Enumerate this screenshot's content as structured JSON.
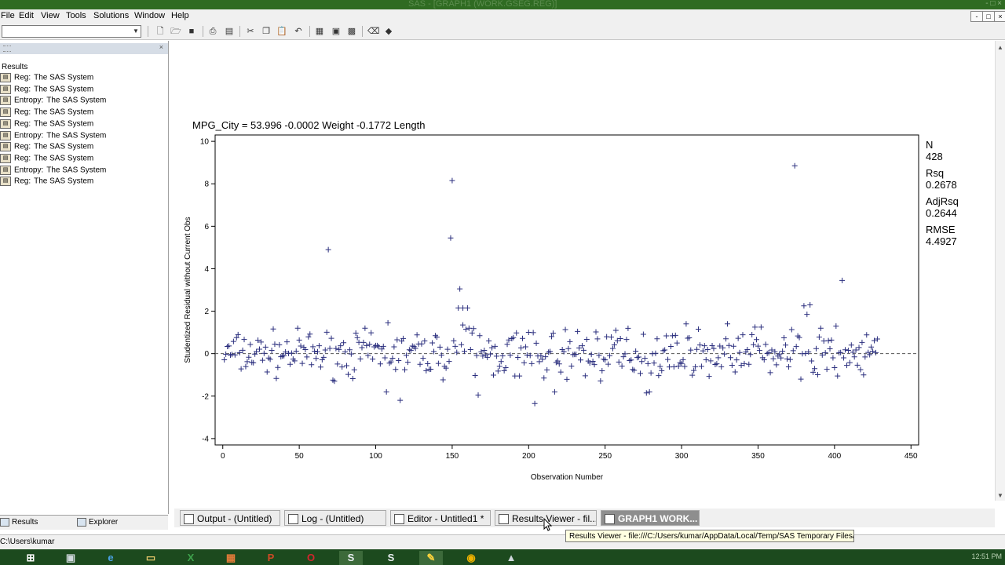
{
  "window": {
    "title": "SAS - [GRAPH1 (WORK.GSEG.REG)]",
    "controls": "- □ ×"
  },
  "menu": [
    "File",
    "Edit",
    "View",
    "Tools",
    "Solutions",
    "Window",
    "Help"
  ],
  "mdi_controls": [
    "-",
    "□",
    "×"
  ],
  "toolbar": {
    "command_value": "",
    "icons": [
      "new-icon",
      "open-icon",
      "save-icon",
      "print-icon",
      "print-preview-icon",
      "cut-icon",
      "copy-icon",
      "paste-icon",
      "undo-icon",
      "results-icon",
      "explorer-icon",
      "libraries-icon",
      "clear-icon",
      "help-icon"
    ]
  },
  "results_pane": {
    "root": "Results",
    "items": [
      {
        "proc": "Reg:",
        "name": "The SAS System"
      },
      {
        "proc": "Reg:",
        "name": "The SAS System"
      },
      {
        "proc": "Entropy:",
        "name": "The SAS System"
      },
      {
        "proc": "Reg:",
        "name": "The SAS System"
      },
      {
        "proc": "Reg:",
        "name": "The SAS System"
      },
      {
        "proc": "Entropy:",
        "name": "The SAS System"
      },
      {
        "proc": "Reg:",
        "name": "The SAS System"
      },
      {
        "proc": "Reg:",
        "name": "The SAS System"
      },
      {
        "proc": "Entropy:",
        "name": "The SAS System"
      },
      {
        "proc": "Reg:",
        "name": "The SAS System"
      }
    ],
    "tabs": [
      "Results",
      "Explorer"
    ]
  },
  "chart_data": {
    "type": "scatter",
    "title": "MPG_City = 53.996 -0.0002 Weight -0.1772 Length",
    "xlabel": "Observation Number",
    "ylabel": "Studentized Residual without Current Obs",
    "xlim": [
      -5,
      455
    ],
    "ylim": [
      -4.3,
      10.3
    ],
    "xticks": [
      0,
      50,
      100,
      150,
      200,
      250,
      300,
      350,
      400,
      450
    ],
    "yticks": [
      -4,
      -2,
      0,
      2,
      4,
      6,
      8,
      10
    ],
    "marker": "plus",
    "marker_color": "#2b2f7e",
    "reference_line_y": 0,
    "stats": [
      {
        "label": "N",
        "value": "428"
      },
      {
        "label": "Rsq",
        "value": "0.2678"
      },
      {
        "label": "AdjRsq",
        "value": "0.2644"
      },
      {
        "label": "RMSE",
        "value": "4.4927"
      }
    ],
    "outliers": [
      [
        69,
        4.9
      ],
      [
        149,
        5.45
      ],
      [
        150,
        8.15
      ],
      [
        155,
        3.05
      ],
      [
        154,
        2.15
      ],
      [
        157,
        2.15
      ],
      [
        160,
        2.15
      ],
      [
        157,
        1.35
      ],
      [
        374,
        8.85
      ],
      [
        405,
        3.45
      ],
      [
        380,
        2.25
      ],
      [
        384,
        2.3
      ],
      [
        382,
        1.85
      ],
      [
        107,
        -1.8
      ],
      [
        116,
        -2.2
      ],
      [
        167,
        -1.95
      ],
      [
        204,
        -2.35
      ],
      [
        108,
        1.45
      ],
      [
        303,
        1.4
      ],
      [
        330,
        1.4
      ],
      [
        348,
        1.25
      ],
      [
        352,
        1.25
      ],
      [
        401,
        1.3
      ],
      [
        194,
        -1.05
      ],
      [
        210,
        -1.15
      ],
      [
        277,
        -1.85
      ],
      [
        279,
        -1.8
      ],
      [
        217,
        -1.8
      ],
      [
        378,
        -1.2
      ],
      [
        402,
        -1.05
      ],
      [
        419,
        -1.0
      ]
    ],
    "n_points": 428
  },
  "window_tabs": [
    {
      "label": "Output - (Untitled)",
      "active": false
    },
    {
      "label": "Log - (Untitled)",
      "active": false
    },
    {
      "label": "Editor - Untitled1 *",
      "active": false
    },
    {
      "label": "Results Viewer - fil...",
      "active": false
    },
    {
      "label": "GRAPH1 WORK...",
      "active": true
    }
  ],
  "tooltip": "Results Viewer - file:///C:/Users/kumar/AppData/Local/Temp/SAS Temporary Files/_",
  "status": {
    "path": "C:\\Users\\kumar"
  },
  "taskbar": {
    "items": [
      "start-icon",
      "server-manager-icon",
      "ie-icon",
      "explorer-folder-icon",
      "excel-icon",
      "app-icon",
      "powerpoint-icon",
      "opera-icon",
      "sas-icon",
      "sas-alt-icon",
      "tool-icon",
      "chrome-icon",
      "misc-icon"
    ],
    "clock": "12:51 PM"
  }
}
